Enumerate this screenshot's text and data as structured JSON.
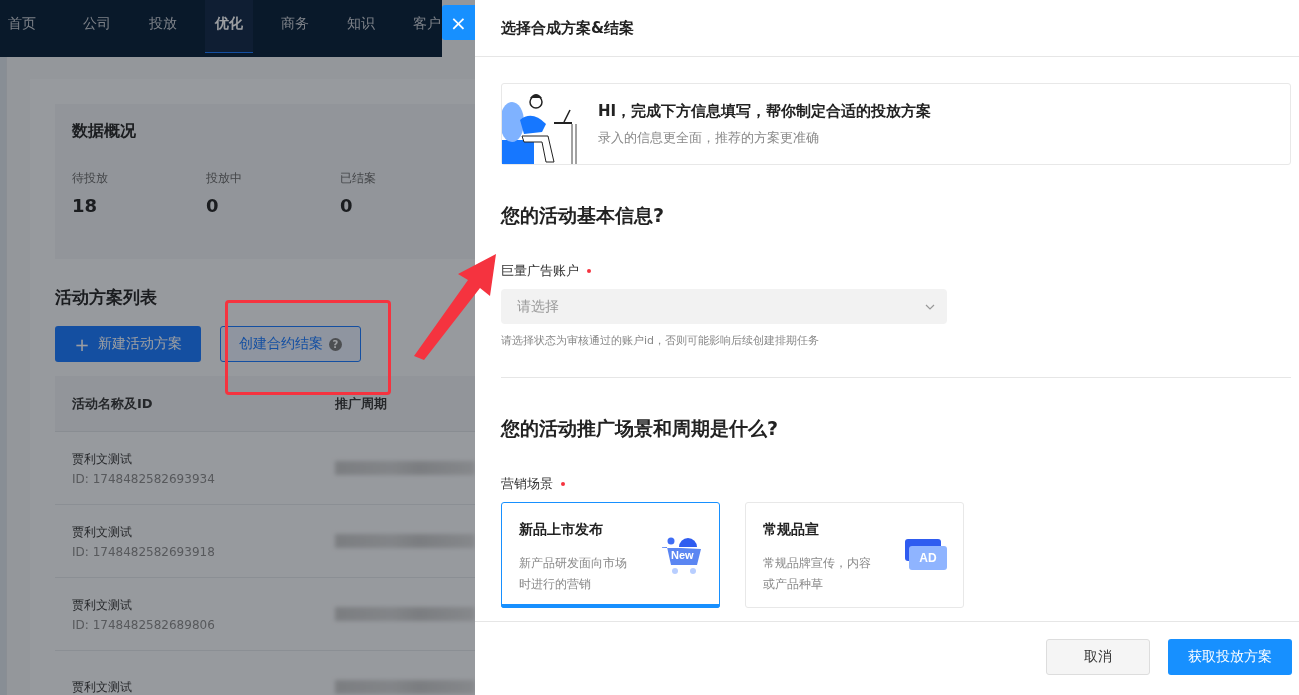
{
  "top_nav": {
    "items": [
      {
        "label": "首页",
        "selected": false
      },
      {
        "label": "公司",
        "selected": false
      },
      {
        "label": "投放",
        "selected": false
      },
      {
        "label": "优化",
        "selected": true
      },
      {
        "label": "商务",
        "selected": false
      },
      {
        "label": "知识",
        "selected": false
      },
      {
        "label": "客户",
        "selected": false
      }
    ]
  },
  "close_button": "×",
  "overview": {
    "title": "数据概况",
    "stats": [
      {
        "label": "待投放",
        "value": "18"
      },
      {
        "label": "投放中",
        "value": "0"
      },
      {
        "label": "已结案",
        "value": "0"
      }
    ]
  },
  "plan_list": {
    "title": "活动方案列表",
    "new_button": {
      "icon": "+",
      "label": "新建活动方案"
    },
    "contract_button": {
      "label": "创建合约结案",
      "help": "?"
    },
    "columns": [
      "活动名称及ID",
      "推广周期"
    ],
    "rows": [
      {
        "name": "贾利文测试",
        "id": "ID: 1748482582693934"
      },
      {
        "name": "贾利文测试",
        "id": "ID: 1748482582693918"
      },
      {
        "name": "贾利文测试",
        "id": "ID: 1748482582689806"
      },
      {
        "name": "贾利文测试"
      }
    ]
  },
  "drawer": {
    "title": "选择合成方案&结案",
    "banner": {
      "title": "HI，完成下方信息填写，帮你制定合适的投放方案",
      "subtitle": "录入的信息更全面，推荐的方案更准确"
    },
    "basic": {
      "heading": "您的活动基本信息?",
      "field": {
        "label": "巨量广告账户",
        "required": true,
        "placeholder": "请选择",
        "hint": "请选择状态为审核通过的账户id，否则可能影响后续创建排期任务"
      }
    },
    "scene": {
      "heading": "您的活动推广场景和周期是什么?",
      "label": "营销场景",
      "required": true,
      "options": [
        {
          "title": "新品上市发布",
          "desc": "新产品研发面向市场时进行的营销",
          "kind": "cart",
          "badge": "New",
          "selected": true
        },
        {
          "title": "常规品宣",
          "desc": "常规品牌宣传，内容或产品种草",
          "kind": "ad",
          "badge": "AD",
          "selected": false
        }
      ]
    },
    "buttons": {
      "cancel": "取消",
      "submit": "获取投放方案"
    }
  }
}
